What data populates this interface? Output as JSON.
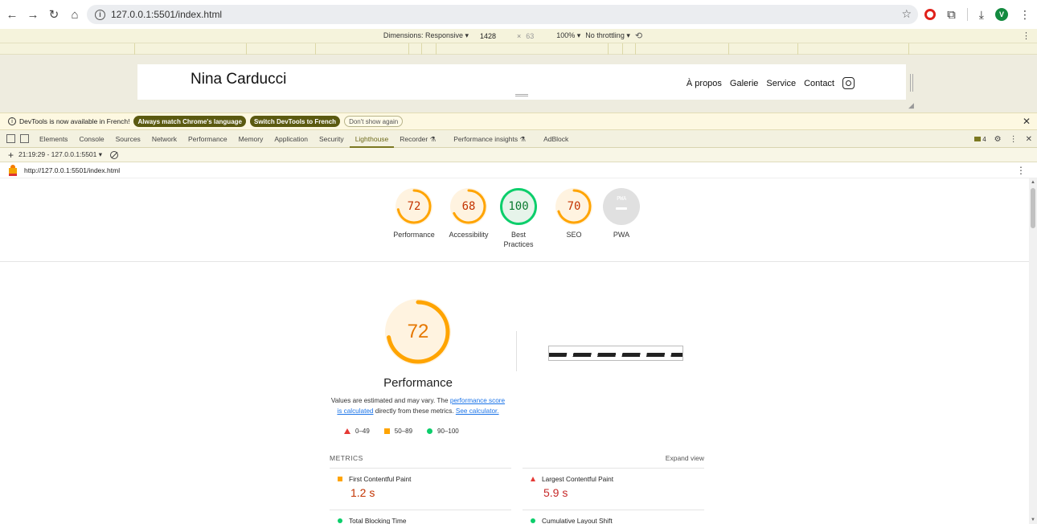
{
  "browser": {
    "url": "127.0.0.1:5501/index.html",
    "profile_initial": "V"
  },
  "device_toolbar": {
    "dimensions_label": "Dimensions: Responsive ▾",
    "width": "1428",
    "times": "×",
    "height": "63",
    "zoom": "100% ▾",
    "throttling": "No throttling ▾"
  },
  "site": {
    "title": "Nina Carducci",
    "nav": [
      "À propos",
      "Galerie",
      "Service",
      "Contact"
    ]
  },
  "infobar": {
    "message": "DevTools is now available in French!",
    "btn_match": "Always match Chrome's language",
    "btn_switch": "Switch DevTools to French",
    "btn_dismiss": "Don't show again"
  },
  "devtools_tabs": [
    "Elements",
    "Console",
    "Sources",
    "Network",
    "Performance",
    "Memory",
    "Application",
    "Security",
    "Lighthouse",
    "Recorder ⚗",
    "Performance insights ⚗",
    "AdBlock"
  ],
  "issues_count": "4",
  "report_bar": {
    "timestamp": "21:19:29 - 127.0.0.1:5501 ▾"
  },
  "report_url": "http://127.0.0.1:5501/index.html",
  "scores": [
    {
      "label": "Performance",
      "value": "72",
      "fraction": 0.72,
      "color": "#ffa400"
    },
    {
      "label": "Accessibility",
      "value": "68",
      "fraction": 0.68,
      "color": "#ffa400"
    },
    {
      "label": "Best Practices",
      "value": "100",
      "fraction": 1.0,
      "color": "#0cce6b"
    },
    {
      "label": "SEO",
      "value": "70",
      "fraction": 0.7,
      "color": "#ffa400"
    },
    {
      "label": "PWA",
      "value": "",
      "fraction": 0,
      "color": "#e0e0e0"
    }
  ],
  "pwa_badge": "PWA",
  "performance": {
    "score": "72",
    "fraction": 0.72,
    "title": "Performance",
    "desc_pre": "Values are estimated and may vary. The ",
    "desc_link1": "performance score is calculated",
    "desc_mid": " directly from these metrics. ",
    "desc_link2": "See calculator."
  },
  "legend": [
    {
      "range": "0–49",
      "kind": "fail"
    },
    {
      "range": "50–89",
      "kind": "average"
    },
    {
      "range": "90–100",
      "kind": "pass"
    }
  ],
  "metrics_header": "METRICS",
  "expand_view": "Expand view",
  "metrics": [
    {
      "name": "First Contentful Paint",
      "value": "1.2 s",
      "status": "average"
    },
    {
      "name": "Largest Contentful Paint",
      "value": "5.9 s",
      "status": "fail"
    },
    {
      "name": "Total Blocking Time",
      "value": "",
      "status": "pass"
    },
    {
      "name": "Cumulative Layout Shift",
      "value": "",
      "status": "pass"
    }
  ]
}
